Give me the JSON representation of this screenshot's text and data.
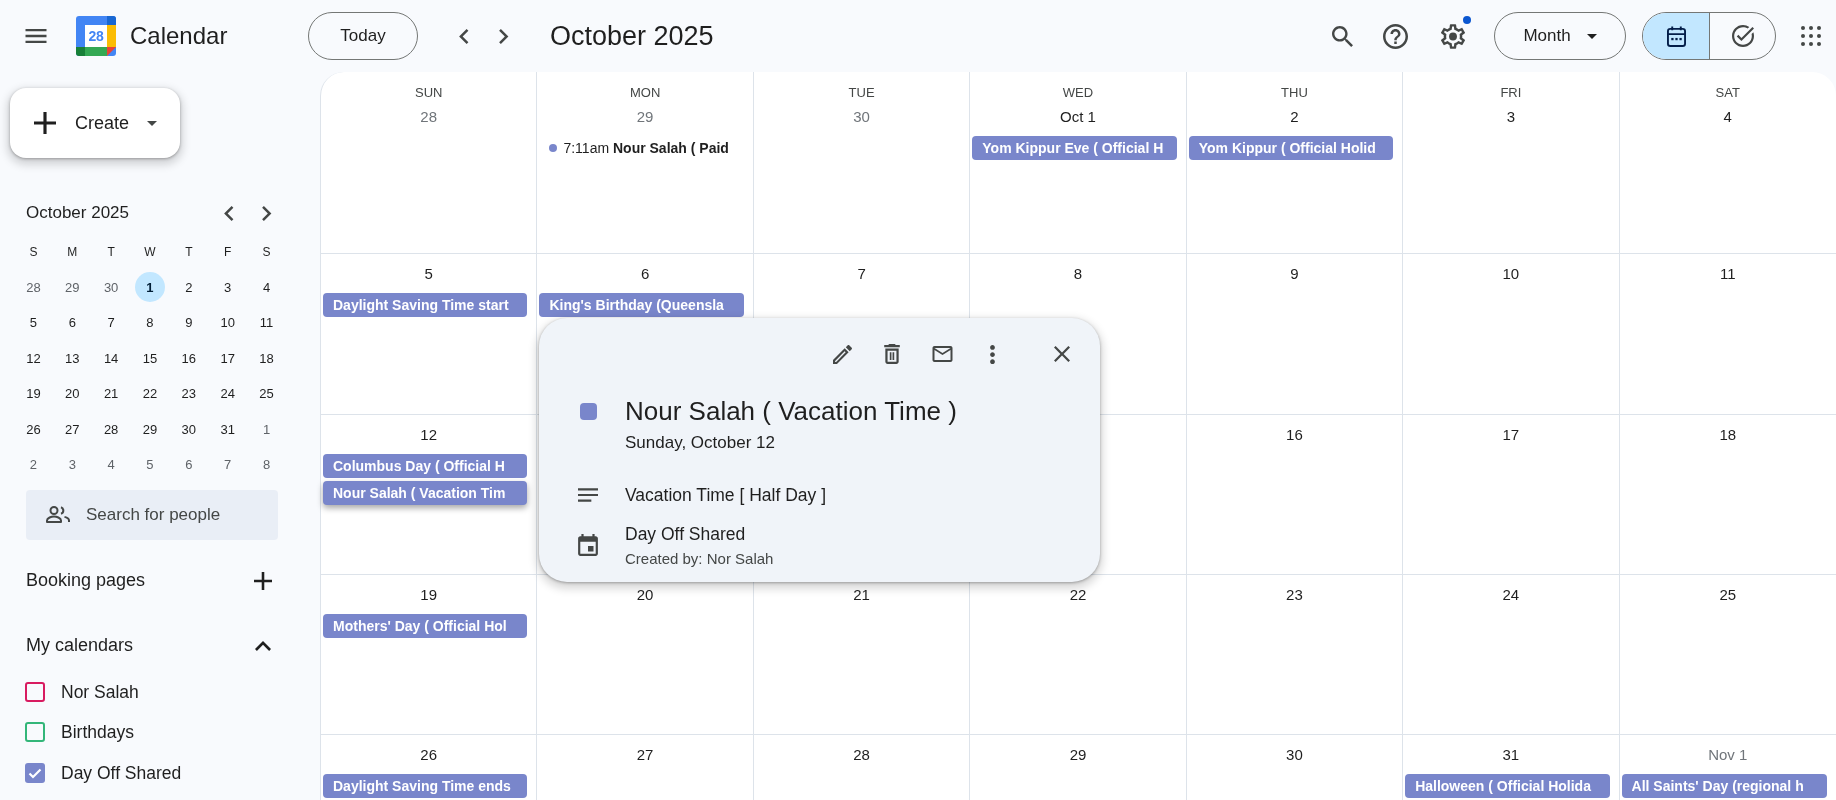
{
  "topbar": {
    "app_name": "Calendar",
    "logo_text": "28",
    "today_button": "Today",
    "period_title": "October 2025",
    "settings_badge": true,
    "view_dropdown": "Month",
    "view_toggle": [
      {
        "kind": "calendar",
        "selected": true
      },
      {
        "kind": "tasks",
        "selected": false
      }
    ]
  },
  "sidebar": {
    "create_button": "Create",
    "mini_calendar": {
      "title": "October 2025",
      "weekdays": [
        "S",
        "M",
        "T",
        "W",
        "T",
        "F",
        "S"
      ],
      "days": [
        {
          "label": "28",
          "outside": true,
          "selected": false
        },
        {
          "label": "29",
          "outside": true,
          "selected": false
        },
        {
          "label": "30",
          "outside": true,
          "selected": false
        },
        {
          "label": "1",
          "outside": false,
          "selected": true
        },
        {
          "label": "2",
          "outside": false,
          "selected": false
        },
        {
          "label": "3",
          "outside": false,
          "selected": false
        },
        {
          "label": "4",
          "outside": false,
          "selected": false
        },
        {
          "label": "5",
          "outside": false,
          "selected": false
        },
        {
          "label": "6",
          "outside": false,
          "selected": false
        },
        {
          "label": "7",
          "outside": false,
          "selected": false
        },
        {
          "label": "8",
          "outside": false,
          "selected": false
        },
        {
          "label": "9",
          "outside": false,
          "selected": false
        },
        {
          "label": "10",
          "outside": false,
          "selected": false
        },
        {
          "label": "11",
          "outside": false,
          "selected": false
        },
        {
          "label": "12",
          "outside": false,
          "selected": false
        },
        {
          "label": "13",
          "outside": false,
          "selected": false
        },
        {
          "label": "14",
          "outside": false,
          "selected": false
        },
        {
          "label": "15",
          "outside": false,
          "selected": false
        },
        {
          "label": "16",
          "outside": false,
          "selected": false
        },
        {
          "label": "17",
          "outside": false,
          "selected": false
        },
        {
          "label": "18",
          "outside": false,
          "selected": false
        },
        {
          "label": "19",
          "outside": false,
          "selected": false
        },
        {
          "label": "20",
          "outside": false,
          "selected": false
        },
        {
          "label": "21",
          "outside": false,
          "selected": false
        },
        {
          "label": "22",
          "outside": false,
          "selected": false
        },
        {
          "label": "23",
          "outside": false,
          "selected": false
        },
        {
          "label": "24",
          "outside": false,
          "selected": false
        },
        {
          "label": "25",
          "outside": false,
          "selected": false
        },
        {
          "label": "26",
          "outside": false,
          "selected": false
        },
        {
          "label": "27",
          "outside": false,
          "selected": false
        },
        {
          "label": "28",
          "outside": false,
          "selected": false
        },
        {
          "label": "29",
          "outside": false,
          "selected": false
        },
        {
          "label": "30",
          "outside": false,
          "selected": false
        },
        {
          "label": "31",
          "outside": false,
          "selected": false
        },
        {
          "label": "1",
          "outside": true,
          "selected": false
        },
        {
          "label": "2",
          "outside": true,
          "selected": false
        },
        {
          "label": "3",
          "outside": true,
          "selected": false
        },
        {
          "label": "4",
          "outside": true,
          "selected": false
        },
        {
          "label": "5",
          "outside": true,
          "selected": false
        },
        {
          "label": "6",
          "outside": true,
          "selected": false
        },
        {
          "label": "7",
          "outside": true,
          "selected": false
        },
        {
          "label": "8",
          "outside": true,
          "selected": false
        }
      ]
    },
    "people_search": {
      "placeholder": "Search for people"
    },
    "booking_pages": {
      "title": "Booking pages"
    },
    "my_calendars": {
      "title": "My calendars",
      "expanded": true,
      "items": [
        {
          "label": "Nor Salah",
          "color": "#d81b60",
          "checked": false
        },
        {
          "label": "Birthdays",
          "color": "#33b679",
          "checked": false
        },
        {
          "label": "Day Off Shared",
          "color": "#7986cb",
          "checked": true
        }
      ]
    }
  },
  "month_grid": {
    "weekdays": [
      "SUN",
      "MON",
      "TUE",
      "WED",
      "THU",
      "FRI",
      "SAT"
    ],
    "weeks": [
      {
        "sun": {
          "date": "28",
          "outside": true
        },
        "mon": {
          "date": "29",
          "outside": true,
          "events": [
            {
              "kind": "timed",
              "time": "7:11am",
              "title": "Nour Salah ( Paid",
              "selected": false
            }
          ]
        },
        "tue": {
          "date": "30",
          "outside": true
        },
        "wed": {
          "date": "Oct 1",
          "outside": false,
          "events": [
            {
              "kind": "chip",
              "title": "Yom Kippur Eve ( Official H",
              "selected": false
            }
          ]
        },
        "thu": {
          "date": "2",
          "outside": false,
          "events": [
            {
              "kind": "chip",
              "title": "Yom Kippur ( Official Holid",
              "selected": false
            }
          ]
        },
        "fri": {
          "date": "3",
          "outside": false
        },
        "sat": {
          "date": "4",
          "outside": false
        }
      },
      {
        "sun": {
          "date": "5",
          "outside": false,
          "events": [
            {
              "kind": "chip",
              "title": "Daylight Saving Time start",
              "selected": false
            }
          ]
        },
        "mon": {
          "date": "6",
          "outside": false,
          "events": [
            {
              "kind": "chip",
              "title": "King's Birthday (Queensla",
              "selected": false
            }
          ]
        },
        "tue": {
          "date": "7",
          "outside": false
        },
        "wed": {
          "date": "8",
          "outside": false
        },
        "thu": {
          "date": "9",
          "outside": false
        },
        "fri": {
          "date": "10",
          "outside": false
        },
        "sat": {
          "date": "11",
          "outside": false
        }
      },
      {
        "sun": {
          "date": "12",
          "outside": false,
          "events": [
            {
              "kind": "chip",
              "title": "Columbus Day ( Official H",
              "selected": false
            },
            {
              "kind": "chip",
              "title": "Nour Salah ( Vacation Tim",
              "selected": true
            }
          ]
        },
        "thu": {
          "date": "16",
          "outside": false
        },
        "fri": {
          "date": "17",
          "outside": false
        },
        "sat": {
          "date": "18",
          "outside": false
        }
      },
      {
        "sun": {
          "date": "19",
          "outside": false,
          "events": [
            {
              "kind": "chip",
              "title": "Mothers' Day ( Official Hol",
              "selected": false
            }
          ]
        },
        "mon": {
          "date": "20",
          "outside": false
        },
        "tue": {
          "date": "21",
          "outside": false
        },
        "wed": {
          "date": "22",
          "outside": false
        },
        "thu": {
          "date": "23",
          "outside": false
        },
        "fri": {
          "date": "24",
          "outside": false
        },
        "sat": {
          "date": "25",
          "outside": false
        }
      },
      {
        "sun": {
          "date": "26",
          "outside": false,
          "events": [
            {
              "kind": "chip",
              "title": "Daylight Saving Time ends",
              "selected": false
            }
          ]
        },
        "mon": {
          "date": "27",
          "outside": false
        },
        "tue": {
          "date": "28",
          "outside": false
        },
        "wed": {
          "date": "29",
          "outside": false
        },
        "thu": {
          "date": "30",
          "outside": false
        },
        "fri": {
          "date": "31",
          "outside": false,
          "events": [
            {
              "kind": "chip",
              "title": "Halloween ( Official Holida",
              "selected": false
            }
          ]
        },
        "sat": {
          "date": "Nov 1",
          "outside": true,
          "events": [
            {
              "kind": "chip",
              "title": "All Saints' Day (regional h",
              "selected": false
            }
          ]
        }
      }
    ]
  },
  "event_popup": {
    "title": "Nour Salah ( Vacation Time )",
    "date": "Sunday, October 12",
    "description": "Vacation Time [ Half Day ]",
    "calendar": "Day Off Shared",
    "created_by": "Created by: Nor Salah"
  }
}
